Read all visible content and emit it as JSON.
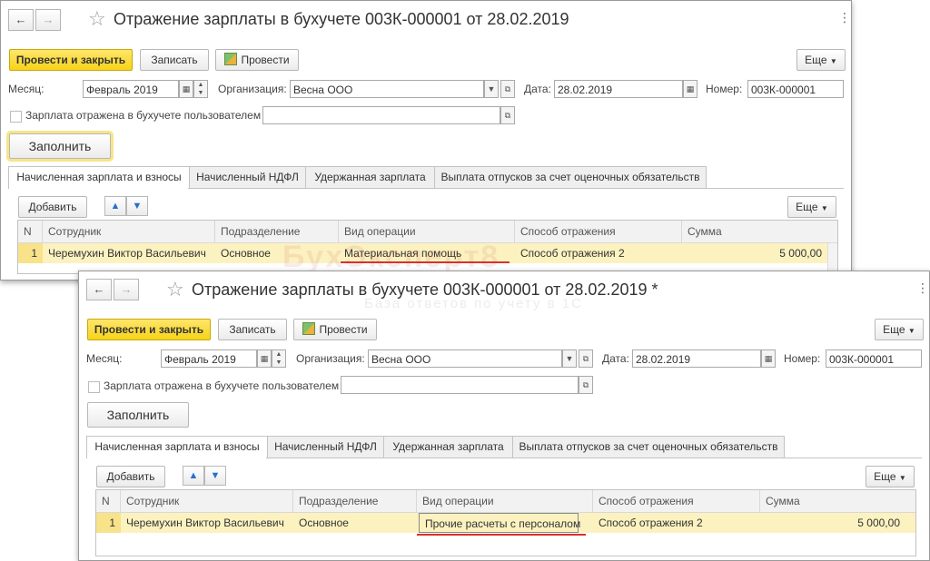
{
  "windows": [
    {
      "title": "Отражение зарплаты в бухучете 003К-000001 от 28.02.2019",
      "toolbar": {
        "post_close": "Провести и закрыть",
        "save": "Записать",
        "post": "Провести",
        "more": "Еще"
      },
      "form": {
        "month_label": "Месяц:",
        "month_value": "Февраль 2019",
        "org_label": "Организация:",
        "org_value": "Весна ООО",
        "date_label": "Дата:",
        "date_value": "28.02.2019",
        "number_label": "Номер:",
        "number_value": "003К-000001",
        "user_reflected_label": "Зарплата отражена в бухучете пользователем",
        "fill_button": "Заполнить"
      },
      "tabs": [
        "Начисленная зарплата и взносы",
        "Начисленный НДФЛ",
        "Удержанная зарплата",
        "Выплата отпусков за счет оценочных обязательств"
      ],
      "table_toolbar": {
        "add": "Добавить",
        "up": "▲",
        "down": "▼",
        "more": "Еще"
      },
      "table": {
        "columns": [
          "N",
          "Сотрудник",
          "Подразделение",
          "Вид операции",
          "Способ отражения",
          "Сумма"
        ],
        "rows": [
          [
            "1",
            "Черемухин Виктор Васильевич",
            "Основное",
            "Материальная помощь",
            "Способ отражения 2",
            "5 000,00"
          ]
        ]
      }
    },
    {
      "title": "Отражение зарплаты в бухучете 003К-000001 от 28.02.2019 *",
      "toolbar": {
        "post_close": "Провести и закрыть",
        "save": "Записать",
        "post": "Провести",
        "more": "Еще"
      },
      "form": {
        "month_label": "Месяц:",
        "month_value": "Февраль 2019",
        "org_label": "Организация:",
        "org_value": "Весна ООО",
        "date_label": "Дата:",
        "date_value": "28.02.2019",
        "number_label": "Номер:",
        "number_value": "003К-000001",
        "user_reflected_label": "Зарплата отражена в бухучете пользователем",
        "fill_button": "Заполнить"
      },
      "tabs": [
        "Начисленная зарплата и взносы",
        "Начисленный НДФЛ",
        "Удержанная зарплата",
        "Выплата отпусков за счет оценочных обязательств"
      ],
      "table_toolbar": {
        "add": "Добавить",
        "up": "▲",
        "down": "▼",
        "more": "Еще"
      },
      "table": {
        "columns": [
          "N",
          "Сотрудник",
          "Подразделение",
          "Вид операции",
          "Способ отражения",
          "Сумма"
        ],
        "rows": [
          [
            "1",
            "Черемухин Виктор Васильевич",
            "Основное",
            "Прочие расчеты с персоналом",
            "Способ отражения 2",
            "5 000,00"
          ]
        ]
      }
    }
  ],
  "watermark": {
    "brand": "БухЭксперт8",
    "tagline": "База ответов по учету в 1С"
  },
  "colors": {
    "accent_yellow": "#f6d31a",
    "row_highlight": "#fbf2c0",
    "underline_red": "#d9302c"
  }
}
